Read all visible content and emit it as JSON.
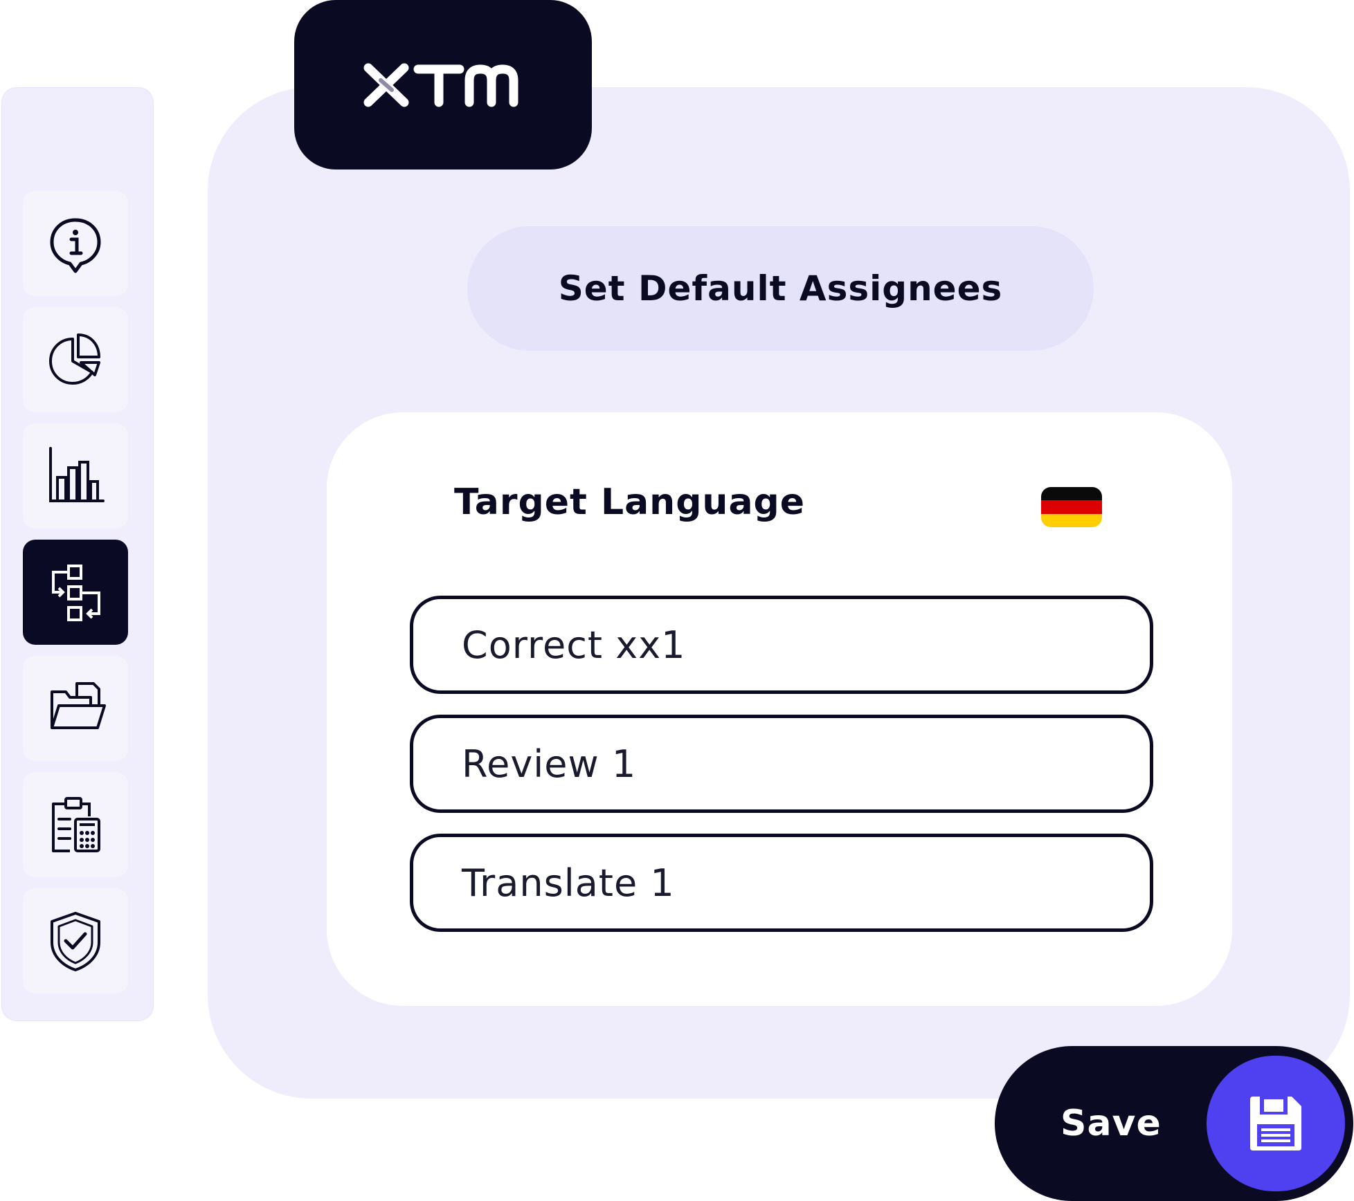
{
  "brand": {
    "name": "XTM",
    "accent_color": "#5546f5",
    "dark_color": "#0a0a22"
  },
  "sidebar": {
    "items": [
      {
        "icon": "info-bubble-icon",
        "active": false
      },
      {
        "icon": "pie-chart-icon",
        "active": false
      },
      {
        "icon": "bar-chart-icon",
        "active": false
      },
      {
        "icon": "workflow-icon",
        "active": true
      },
      {
        "icon": "folder-icon",
        "active": false
      },
      {
        "icon": "clipboard-calculator-icon",
        "active": false
      },
      {
        "icon": "shield-check-icon",
        "active": false
      }
    ]
  },
  "header": {
    "title": "Set Default Assignees"
  },
  "card": {
    "title": "Target Language",
    "flag_icon": "germany-flag-icon",
    "flag_colors": [
      "#000000",
      "#dd0000",
      "#ffce00"
    ],
    "fields": [
      {
        "value": "Correct xx1"
      },
      {
        "value": "Review 1"
      },
      {
        "value": "Translate 1"
      }
    ]
  },
  "save_button": {
    "label": "Save",
    "icon": "floppy-disk-icon",
    "icon_bg": "#4f40f0"
  }
}
